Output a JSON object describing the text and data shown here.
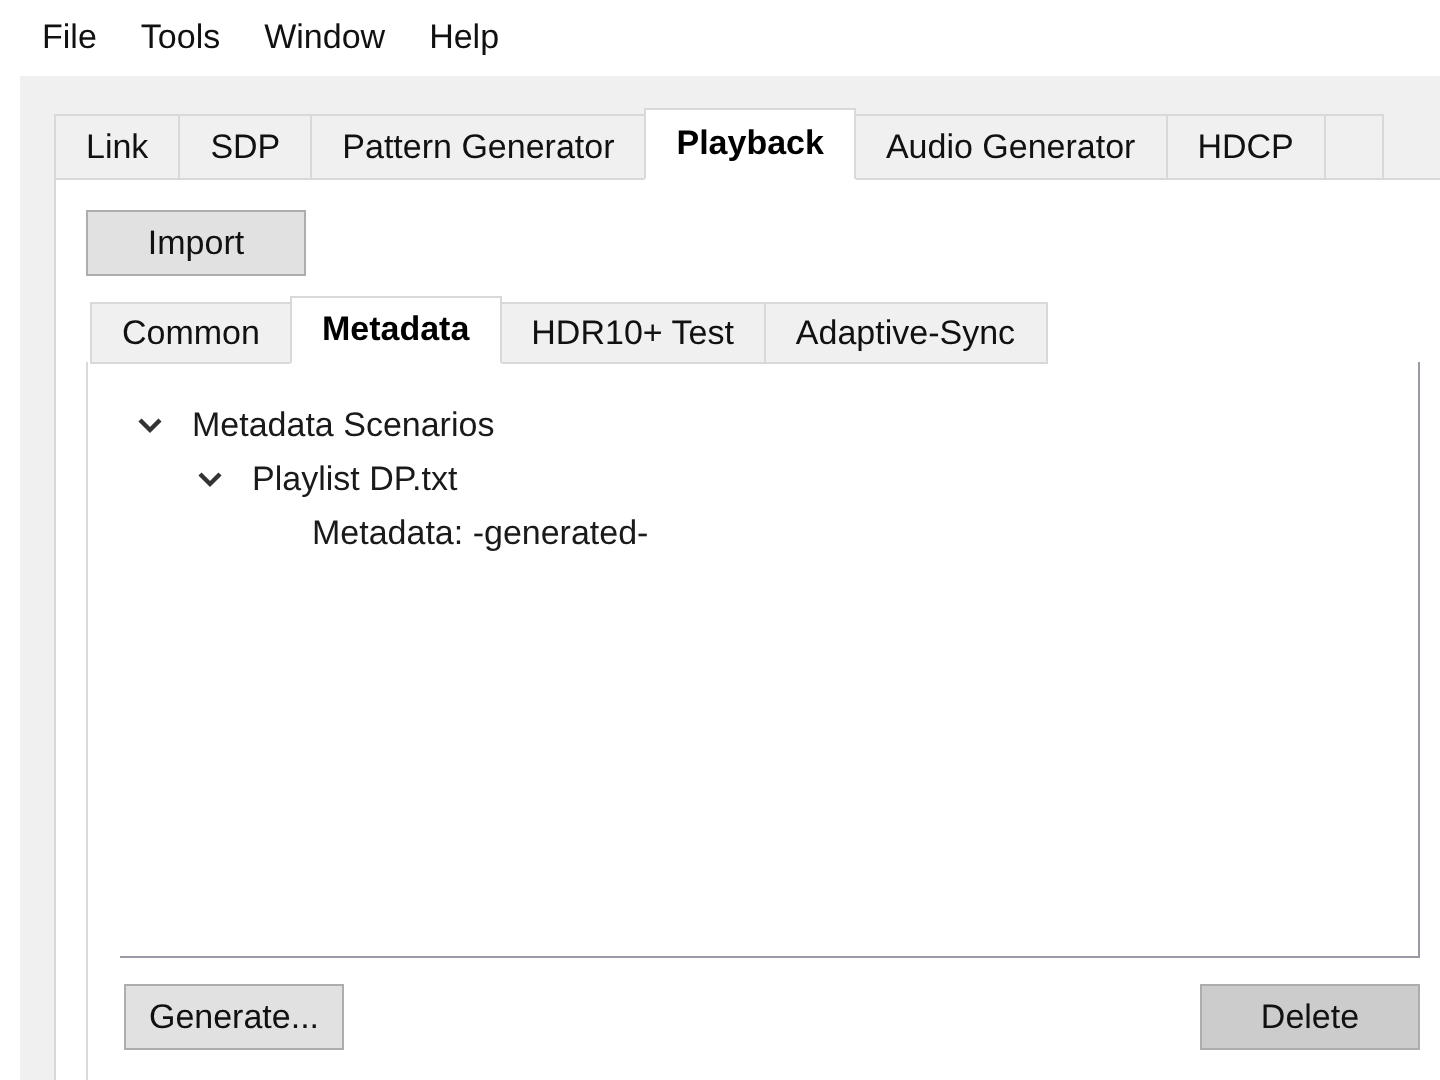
{
  "menu": [
    "File",
    "Tools",
    "Window",
    "Help"
  ],
  "tabs": [
    {
      "label": "Link",
      "selected": false
    },
    {
      "label": "SDP",
      "selected": false
    },
    {
      "label": "Pattern Generator",
      "selected": false
    },
    {
      "label": "Playback",
      "selected": true
    },
    {
      "label": "Audio Generator",
      "selected": false
    },
    {
      "label": "HDCP",
      "selected": false
    }
  ],
  "import_button": "Import",
  "subtabs": [
    {
      "label": "Common",
      "selected": false
    },
    {
      "label": "Metadata",
      "selected": true
    },
    {
      "label": "HDR10+ Test",
      "selected": false
    },
    {
      "label": "Adaptive-Sync",
      "selected": false
    }
  ],
  "tree": [
    {
      "label": "Metadata Scenarios",
      "expanded": true,
      "children": [
        {
          "label": "Playlist DP.txt",
          "expanded": true,
          "children": [
            {
              "label": "Metadata: -generated-"
            }
          ]
        }
      ]
    }
  ],
  "buttons": [
    {
      "label": "Generate..."
    },
    {
      "label": "Delete"
    }
  ]
}
